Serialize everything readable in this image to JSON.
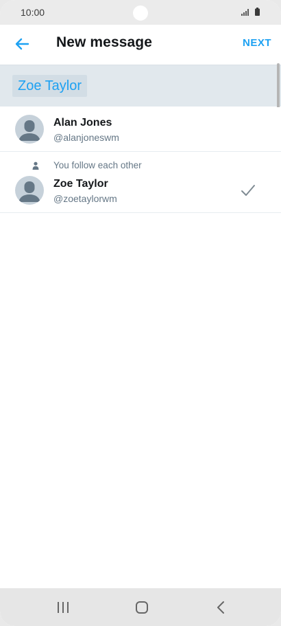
{
  "status_bar": {
    "time": "10:00",
    "icons": [
      "signal-icon",
      "battery-icon"
    ]
  },
  "header": {
    "title": "New message",
    "back_icon": "arrow-left-icon",
    "next_label": "NEXT"
  },
  "recipients": [
    {
      "name": "Zoe Taylor"
    }
  ],
  "results": [
    {
      "name": "Alan Jones",
      "handle": "@alanjoneswm",
      "follow_note": "",
      "selected": false
    },
    {
      "name": "Zoe Taylor",
      "handle": "@zoetaylorwm",
      "follow_note": "You follow each other",
      "selected": true
    }
  ],
  "nav_bar": {
    "buttons": [
      "recent-apps-icon",
      "home-icon",
      "back-icon"
    ]
  },
  "colors": {
    "accent": "#1da1f2",
    "recipient_bar": "#e1e8ed",
    "text_primary": "#14171a",
    "text_secondary": "#657786"
  }
}
